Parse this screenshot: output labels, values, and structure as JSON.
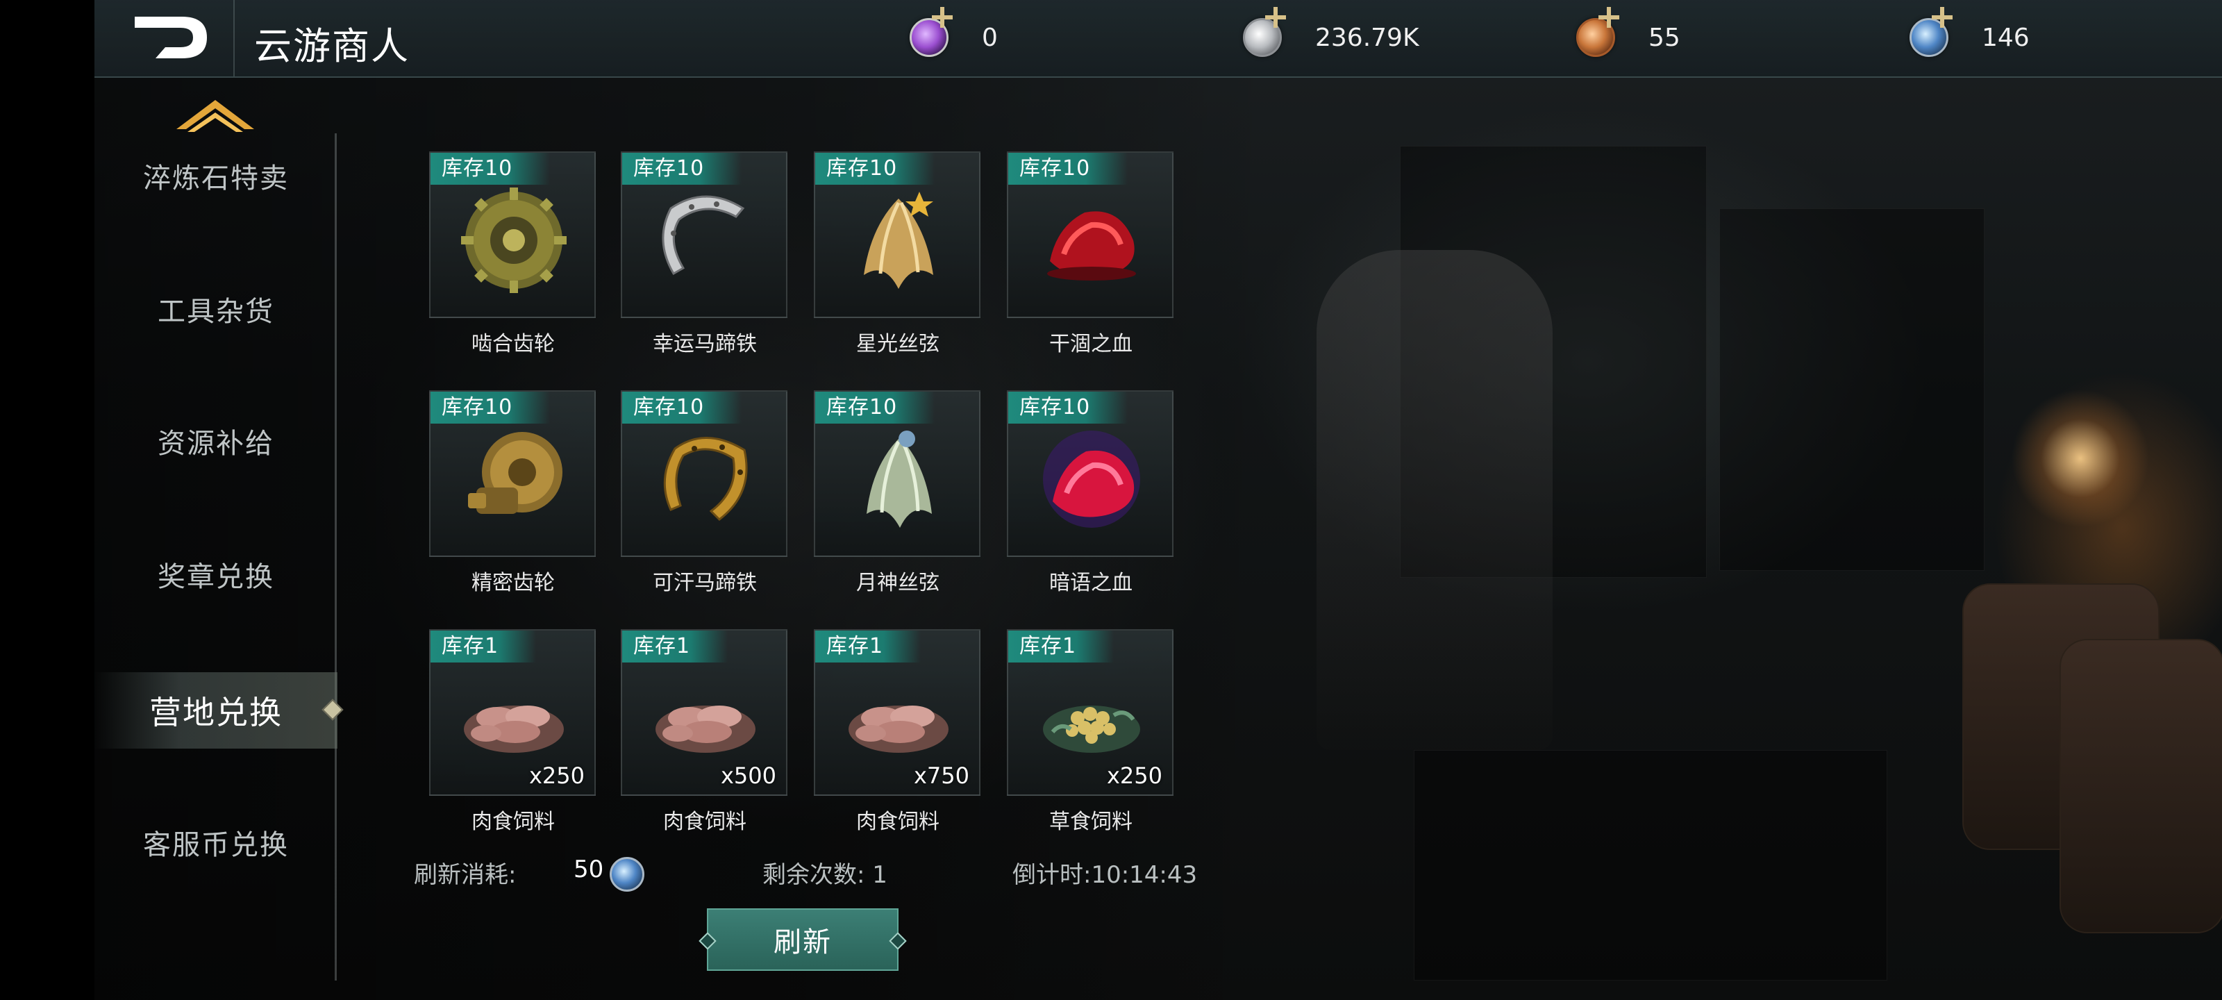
{
  "header": {
    "title": "云游商人",
    "back_icon": "back-arrow-icon",
    "currencies": [
      {
        "name": "purple-gem-icon",
        "value": "0",
        "color": "#9b4fd0"
      },
      {
        "name": "silver-coin-icon",
        "value": "236.79K",
        "color": "#b9bcc0"
      },
      {
        "name": "bronze-medal-icon",
        "value": "55",
        "color": "#c9763a"
      },
      {
        "name": "blue-orb-icon",
        "value": "146",
        "color": "#4f86c6"
      }
    ]
  },
  "sidebar": {
    "items": [
      {
        "label": "淬炼石特卖"
      },
      {
        "label": "工具杂货"
      },
      {
        "label": "资源补给"
      },
      {
        "label": "奖章兑换"
      },
      {
        "label": "营地兑换",
        "active": true
      },
      {
        "label": "客服币兑换"
      }
    ]
  },
  "shop": {
    "items": [
      {
        "stock": "库存10",
        "name": "啮合齿轮",
        "icon": "brass-gear-icon"
      },
      {
        "stock": "库存10",
        "name": "幸运马蹄铁",
        "icon": "silver-horseshoe-icon"
      },
      {
        "stock": "库存10",
        "name": "星光丝弦",
        "icon": "golden-strings-icon"
      },
      {
        "stock": "库存10",
        "name": "干涸之血",
        "icon": "red-blood-crystal-icon"
      },
      {
        "stock": "库存10",
        "name": "精密齿轮",
        "icon": "precision-gear-icon"
      },
      {
        "stock": "库存10",
        "name": "可汗马蹄铁",
        "icon": "gold-horseshoe-icon"
      },
      {
        "stock": "库存10",
        "name": "月神丝弦",
        "icon": "silver-strings-icon"
      },
      {
        "stock": "库存10",
        "name": "暗语之血",
        "icon": "crimson-blood-crystal-icon"
      },
      {
        "stock": "库存1",
        "name": "肉食饲料",
        "qty": "x250",
        "icon": "meat-feed-icon"
      },
      {
        "stock": "库存1",
        "name": "肉食饲料",
        "qty": "x500",
        "icon": "meat-feed-icon"
      },
      {
        "stock": "库存1",
        "name": "肉食饲料",
        "qty": "x750",
        "icon": "meat-feed-icon"
      },
      {
        "stock": "库存1",
        "name": "草食饲料",
        "qty": "x250",
        "icon": "herb-feed-icon"
      }
    ]
  },
  "footer": {
    "refresh_cost_label": "刷新消耗:",
    "refresh_cost_value": "50",
    "remaining_text": "剩余次数: 1",
    "countdown_text": "倒计时:10:14:43",
    "refresh_button": "刷新"
  }
}
